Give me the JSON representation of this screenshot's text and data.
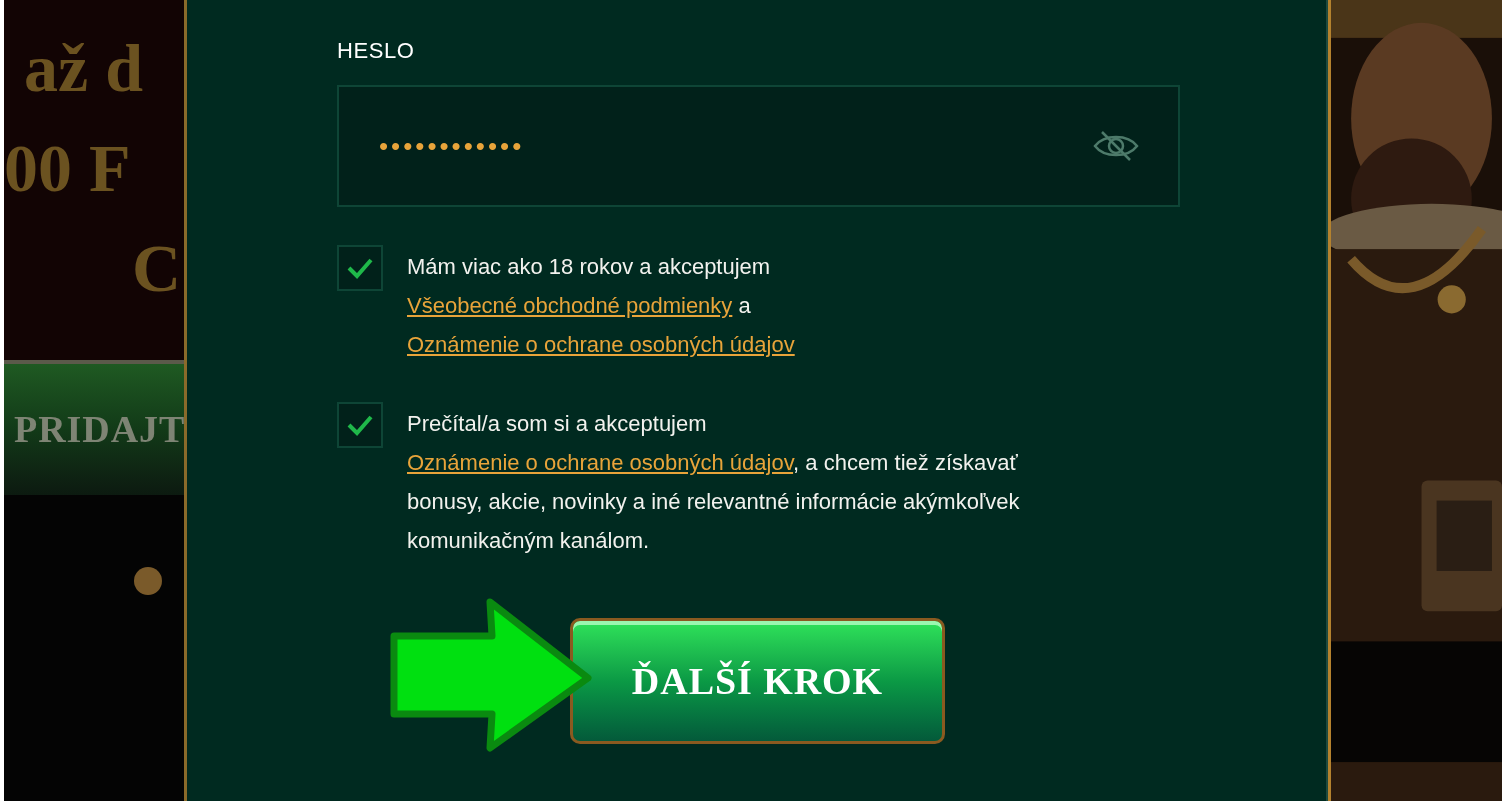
{
  "background": {
    "headline_lines": [
      "až d",
      "00 F",
      "C"
    ],
    "banner_label": "PRIDAJT"
  },
  "form": {
    "password": {
      "label": "HESLO",
      "value": "••••••••••••",
      "visible": false
    },
    "consents": [
      {
        "checked": true,
        "lines": [
          [
            {
              "kind": "text",
              "text": "Mám viac ako 18 rokov a akceptujem"
            }
          ],
          [
            {
              "kind": "link",
              "text": "Všeobecné obchodné podmienky"
            },
            {
              "kind": "text",
              "text": " a"
            }
          ],
          [
            {
              "kind": "link",
              "text": "Oznámenie o ochrane osobných údajov"
            }
          ]
        ]
      },
      {
        "checked": true,
        "lines": [
          [
            {
              "kind": "text",
              "text": "Prečítal/a som si a akceptujem"
            }
          ],
          [
            {
              "kind": "link",
              "text": "Oznámenie o ochrane osobných údajov"
            },
            {
              "kind": "text",
              "text": ", a chcem tiež získavať bonusy, akcie, novinky a iné relevantné informácie akýmkoľvek komunikačným kanálom."
            }
          ]
        ]
      }
    ],
    "submit_button": "ĎALŠÍ KROK"
  }
}
